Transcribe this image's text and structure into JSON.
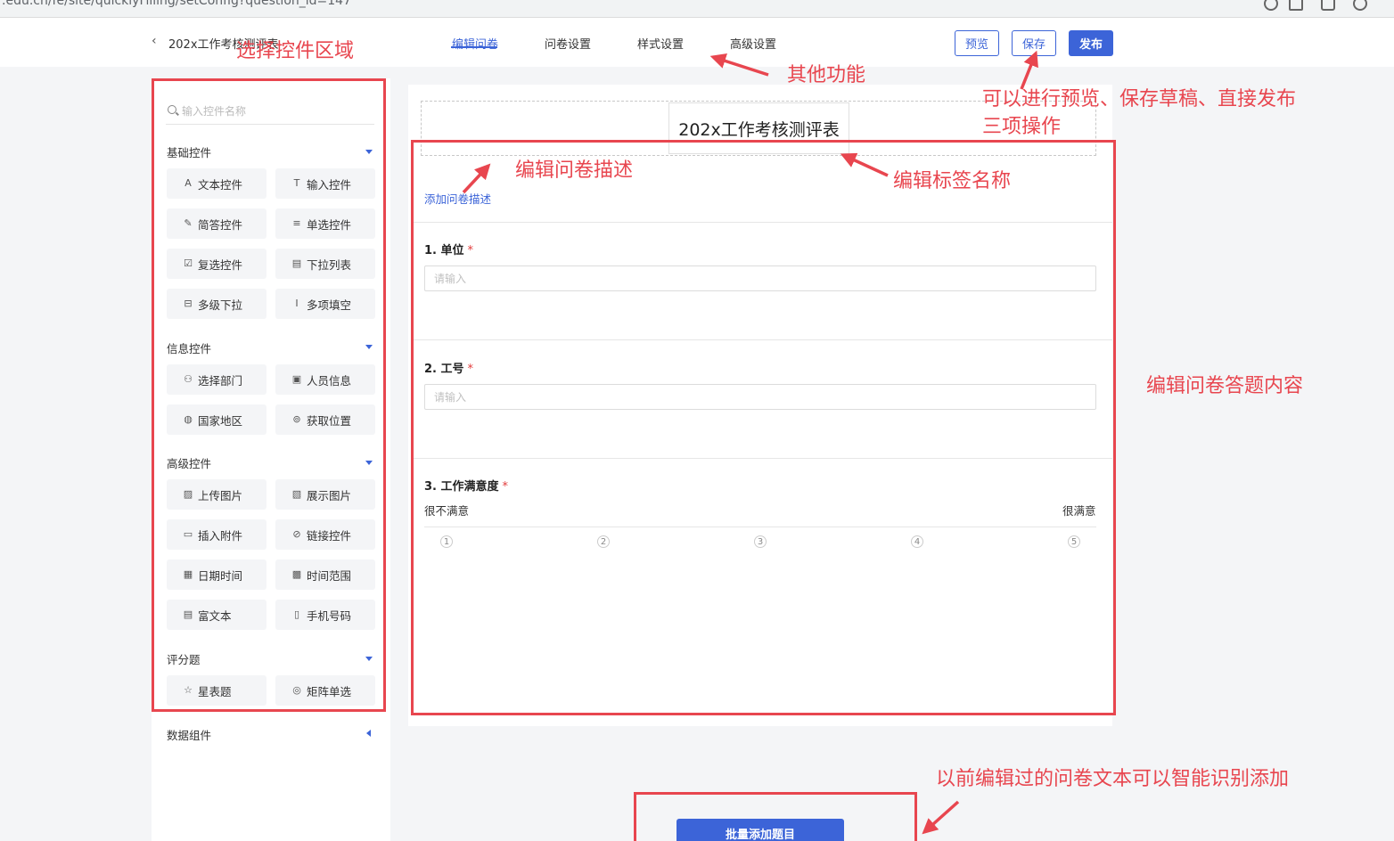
{
  "browser": {
    "url": ".edu.cn/fe/site/quicklyFilling/setConfig?question_id=147"
  },
  "header": {
    "back_icon": "‹",
    "doc_title": "202x工作考核测评表",
    "tabs": [
      {
        "label": "编辑问卷",
        "active": true
      },
      {
        "label": "问卷设置",
        "active": false
      },
      {
        "label": "样式设置",
        "active": false
      },
      {
        "label": "高级设置",
        "active": false
      }
    ],
    "preview_label": "预览",
    "save_label": "保存",
    "publish_label": "发布"
  },
  "sidebar": {
    "search_placeholder": "输入控件名称",
    "groups": [
      {
        "title": "基础控件",
        "items": [
          {
            "label": "文本控件",
            "icon": "A"
          },
          {
            "label": "输入控件",
            "icon": "T"
          },
          {
            "label": "简答控件",
            "icon": "✎"
          },
          {
            "label": "单选控件",
            "icon": "≡"
          },
          {
            "label": "复选控件",
            "icon": "☑"
          },
          {
            "label": "下拉列表",
            "icon": "▤"
          },
          {
            "label": "多级下拉",
            "icon": "⊟"
          },
          {
            "label": "多项填空",
            "icon": "Ⅰ"
          }
        ]
      },
      {
        "title": "信息控件",
        "items": [
          {
            "label": "选择部门",
            "icon": "⚇"
          },
          {
            "label": "人员信息",
            "icon": "▣"
          },
          {
            "label": "国家地区",
            "icon": "◍"
          },
          {
            "label": "获取位置",
            "icon": "⊚"
          }
        ]
      },
      {
        "title": "高级控件",
        "items": [
          {
            "label": "上传图片",
            "icon": "▨"
          },
          {
            "label": "展示图片",
            "icon": "▧"
          },
          {
            "label": "插入附件",
            "icon": "▭"
          },
          {
            "label": "链接控件",
            "icon": "⊘"
          },
          {
            "label": "日期时间",
            "icon": "▦"
          },
          {
            "label": "时间范围",
            "icon": "▩"
          },
          {
            "label": "富文本",
            "icon": "▤"
          },
          {
            "label": "手机号码",
            "icon": "▯"
          }
        ]
      },
      {
        "title": "评分题",
        "items": [
          {
            "label": "星表题",
            "icon": "☆"
          },
          {
            "label": "矩阵单选",
            "icon": "◎"
          }
        ]
      }
    ],
    "collapsed_group": "数据组件"
  },
  "form": {
    "title": "202x工作考核测评表",
    "add_description": "添加问卷描述",
    "questions": [
      {
        "title": "1. 单位",
        "required": "*",
        "placeholder": "请输入"
      },
      {
        "title": "2. 工号",
        "required": "*",
        "placeholder": "请输入"
      },
      {
        "title": "3. 工作满意度",
        "required": "*",
        "low_label": "很不满意",
        "high_label": "很满意",
        "scale": [
          "1",
          "2",
          "3",
          "4",
          "5"
        ]
      }
    ]
  },
  "batch_add_label": "批量添加题目",
  "annotations": {
    "select_area": "选择控件区域",
    "other_functions": "其他功能",
    "save_ops_line1": "可以进行预览、保存草稿、直接发布",
    "save_ops_line2": "三项操作",
    "edit_description": "编辑问卷描述",
    "edit_label_name": "编辑标签名称",
    "edit_content": "编辑问卷答题内容",
    "smart_import": "以前编辑过的问卷文本可以智能识别添加"
  },
  "colors": {
    "accent": "#3c64d8",
    "annotation_red": "#e8464f",
    "required_red": "#e23c3c"
  }
}
